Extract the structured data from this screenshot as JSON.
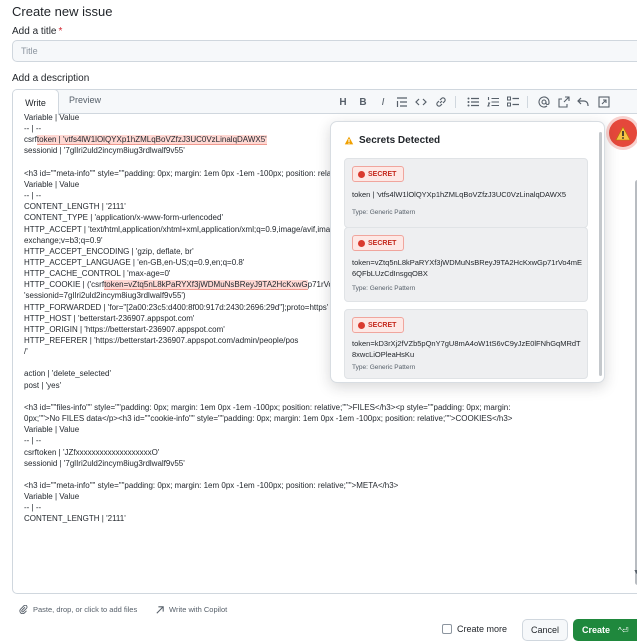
{
  "page": {
    "title": "Create new issue"
  },
  "form": {
    "title_label": "Add a title",
    "required_mark": "*",
    "title_placeholder": "Title",
    "description_label": "Add a description"
  },
  "editor": {
    "tabs": {
      "write": "Write",
      "preview": "Preview"
    },
    "toolbar": {
      "heading": "H",
      "bold": "B",
      "italic": "I",
      "icons": [
        "quote-icon",
        "code-icon",
        "link-icon",
        "bullet-list-icon",
        "numbered-list-icon",
        "task-list-icon",
        "mention-icon",
        "reference-icon",
        "undo-icon",
        "fullscreen-icon"
      ]
    },
    "lines": [
      "Variable | Value",
      "-- | --",
      "csrftoken | 'vtfs4lW1lOlQYXp1hZMLqBoVZfzJ3UC0VzLinalqDAWX5'",
      "sessionid | '7glIri2uld2incym8iug3rdlwalf9v55'",
      "",
      "<h3 id=\"\"meta-info\"\" style=\"\"padding: 0px; margin: 1em 0px -1em -100px; position: relative;\"\">META</h3>",
      "Variable | Value",
      "-- | --",
      "CONTENT_LENGTH | '2111'",
      "CONTENT_TYPE | 'application/x-www-form-urlencoded'",
      "HTTP_ACCEPT | 'text/html,application/xhtml+xml,application/xml;q=0.9,image/avif,image/webp,image/apng,*/*;q=0.8,application/signed-",
      "exchange;v=b3;q=0.9'",
      "HTTP_ACCEPT_ENCODING | 'gzip, deflate, br'",
      "HTTP_ACCEPT_LANGUAGE | 'en-GB,en-US;q=0.9,en;q=0.8'",
      "HTTP_CACHE_CONTROL | 'max-age=0'",
      "HTTP_COOKIE | ('csrftoken=vZtq5nL8kPaRYXf3jWDMuNsBReyJ9TA2HcKxwGp71rVo4mE6QFbLUzCdInsgqOBX; '",
      "'sessionid=7glIri2uld2incym8iug3rdlwalf9v55')",
      "HTTP_FORWARDED | 'for=\"[2a00:23c5:d400:8f00:917d:2430:2696:29d\"];proto=https'",
      "HTTP_HOST | 'betterstart-236907.appspot.com'",
      "HTTP_ORIGIN | 'https://betterstart-236907.appspot.com'",
      "HTTP_REFERER | 'https://betterstart-236907.appspot.com/admin/people/pos",
      "/'",
      "",
      "action | 'delete_selected'",
      "post | 'yes'",
      "",
      "<h3 id=\"\"files-info\"\" style=\"\"padding: 0px; margin: 1em 0px -1em -100px; position: relative;\"\">FILES</h3><p style=\"\"padding: 0px; margin:",
      "0px;\"\">No FILES data</p><h3 id=\"\"cookie-info\"\" style=\"\"padding: 0px; margin: 1em 0px -1em -100px; position: relative;\"\">COOKIES</h3>",
      "Variable | Value",
      "-- | --",
      "csrftoken | 'JZfxxxxxxxxxxxxxxxxxxxO'",
      "sessionid | '7glIri2uld2incym8iug3rdlwalf9v55'",
      "",
      "<h3 id=\"\"meta-info\"\" style=\"\"padding: 0px; margin: 1em 0px -1em -100px; position: relative;\"\">META</h3>",
      "Variable | Value",
      "-- | --",
      "CONTENT_LENGTH | '2111'"
    ],
    "highlights": [
      {
        "line": 2,
        "text": "token | 'vtfs4lW1lOlQYXp1hZMLqBoVZfzJ3UC0VzLinalqDAWX5'"
      },
      {
        "line": 15,
        "text": "token=vZtq5nL8kPaRYXf3jWDMuNsBReyJ9TA2HcKxwG"
      }
    ]
  },
  "secrets_popover": {
    "title": "Secrets Detected",
    "items": [
      {
        "badge": "SECRET",
        "value": "token | 'vtfs4lW1lOlQYXp1hZMLqBoVZfzJ3UC0VzLinalqDAWX5",
        "type": "Type: Generic Pattern"
      },
      {
        "badge": "SECRET",
        "value": "token=vZtq5nL8kPaRYXf3jWDMuNsBReyJ9TA2HcKxwGp71rVo4mE6QFbLUzCdInsgqOBX",
        "type": "Type: Generic Pattern"
      },
      {
        "badge": "SECRET",
        "value": "token=kD3rXj2fVZb5pQnY7gU8mA4oW1tS6vC9yJzE0lFNhGqMRdT8xwcLiOPleaHsKu",
        "type": "Type: Generic Pattern"
      }
    ]
  },
  "footer": {
    "attach_text": "Paste, drop, or click to add files",
    "copilot_text": "Write with Copilot",
    "create_more_label": "Create more",
    "cancel_label": "Cancel",
    "create_label": "Create",
    "create_shortcut": "^⏎"
  },
  "colors": {
    "accent_green": "#1f883d",
    "secret_red": "#d93a2e",
    "highlight_bg": "#ffd8d3"
  }
}
